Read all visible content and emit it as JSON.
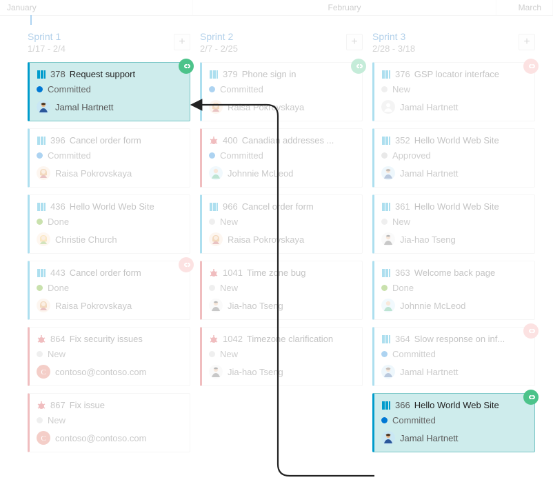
{
  "months": {
    "jan": "January",
    "feb": "February",
    "mar": "March"
  },
  "sprints": [
    {
      "name": "Sprint 1",
      "dates": "1/17 - 2/4"
    },
    {
      "name": "Sprint 2",
      "dates": "2/7 - 2/25"
    },
    {
      "name": "Sprint 3",
      "dates": "2/28 - 3/18"
    }
  ],
  "s1": [
    {
      "type": "pbi",
      "id": "378",
      "title": "Request support",
      "state": "Committed",
      "person": "Jamal Hartnett",
      "avatar": "m1",
      "link": "green",
      "hl": true
    },
    {
      "type": "pbi",
      "id": "396",
      "title": "Cancel order form",
      "state": "Committed",
      "person": "Raisa Pokrovskaya",
      "avatar": "f1"
    },
    {
      "type": "pbi",
      "id": "436",
      "title": "Hello World Web Site",
      "state": "Done",
      "person": "Christie Church",
      "avatar": "f2"
    },
    {
      "type": "pbi",
      "id": "443",
      "title": "Cancel order form",
      "state": "Done",
      "person": "Raisa Pokrovskaya",
      "avatar": "f1",
      "link": "red"
    },
    {
      "type": "bug",
      "id": "864",
      "title": "Fix security issues",
      "state": "New",
      "person": "contoso@contoso.com",
      "avatar": "c"
    },
    {
      "type": "bug",
      "id": "867",
      "title": "Fix issue",
      "state": "New",
      "person": "contoso@contoso.com",
      "avatar": "c"
    }
  ],
  "s2": [
    {
      "type": "pbi",
      "id": "379",
      "title": "Phone sign in",
      "state": "Committed",
      "person": "Raisa Pokrovskaya",
      "avatar": "f1",
      "link": "green"
    },
    {
      "type": "bug",
      "id": "400",
      "title": "Canadian addresses ...",
      "state": "Committed",
      "person": "Johnnie McLeod",
      "avatar": "m2"
    },
    {
      "type": "pbi",
      "id": "966",
      "title": "Cancel order form",
      "state": "New",
      "person": "Raisa Pokrovskaya",
      "avatar": "f1"
    },
    {
      "type": "bug",
      "id": "1041",
      "title": "Time zone bug",
      "state": "New",
      "person": "Jia-hao Tseng",
      "avatar": "m3"
    },
    {
      "type": "bug",
      "id": "1042",
      "title": "Timezone clarification",
      "state": "New",
      "person": "Jia-hao Tseng",
      "avatar": "m3"
    }
  ],
  "s3": [
    {
      "type": "pbi",
      "id": "376",
      "title": "GSP locator interface",
      "state": "New",
      "person": "Jamal Hartnett",
      "avatar": "none",
      "link": "red"
    },
    {
      "type": "pbi",
      "id": "352",
      "title": "Hello World Web Site",
      "state": "Approved",
      "person": "Jamal Hartnett",
      "avatar": "m1"
    },
    {
      "type": "pbi",
      "id": "361",
      "title": "Hello World Web Site",
      "state": "New",
      "person": "Jia-hao Tseng",
      "avatar": "m3"
    },
    {
      "type": "pbi",
      "id": "363",
      "title": "Welcome back page",
      "state": "Done",
      "person": "Johnnie McLeod",
      "avatar": "m2"
    },
    {
      "type": "pbi",
      "id": "364",
      "title": "Slow response on inf...",
      "state": "Committed",
      "person": "Jamal Hartnett",
      "avatar": "m1",
      "link": "red"
    },
    {
      "type": "pbi",
      "id": "366",
      "title": "Hello World Web Site",
      "state": "Committed",
      "person": "Jamal Hartnett",
      "avatar": "m1",
      "link": "green",
      "hl": true
    }
  ]
}
